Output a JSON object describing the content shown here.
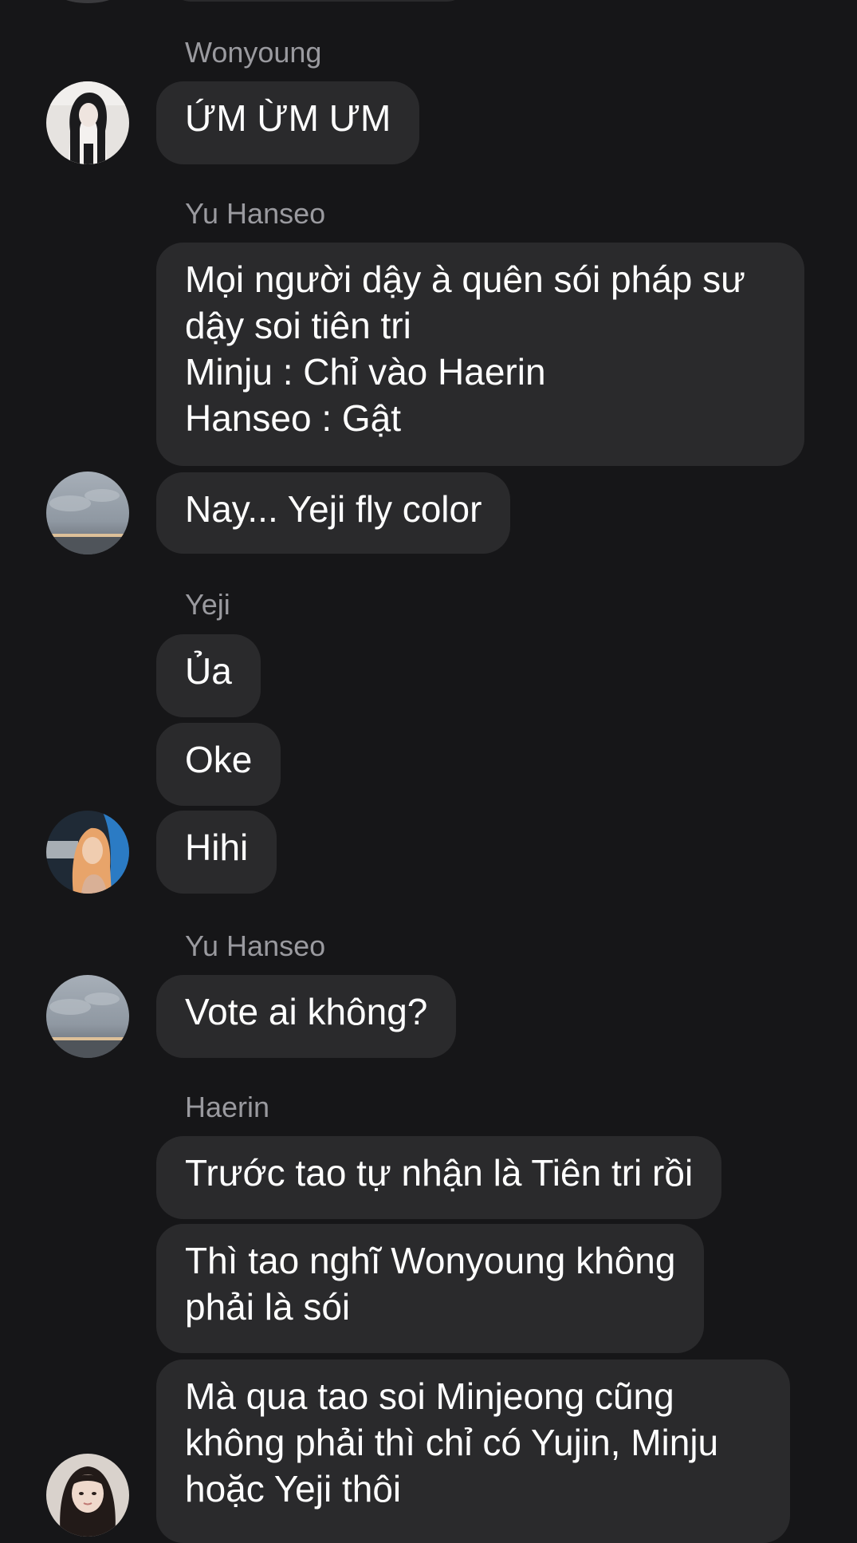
{
  "messages": [
    {
      "sender": "Wonyoung",
      "text": "ỨM ỪM ƯM"
    },
    {
      "sender": "Yu Hanseo",
      "text": "Mọi người dậy à quên sói pháp sư\ndậy soi tiên tri\nMinju : Chỉ vào Haerin\nHanseo : Gật"
    },
    {
      "text": "Nay... Yeji fly color"
    },
    {
      "sender": "Yeji",
      "text": "Ủa"
    },
    {
      "text": "Oke"
    },
    {
      "text": "Hihi"
    },
    {
      "sender": "Yu Hanseo",
      "text": "Vote ai không?"
    },
    {
      "sender": "Haerin",
      "text": "Trước tao tự nhận là Tiên tri rồi"
    },
    {
      "text": "Thì tao nghĩ Wonyoung không\nphải là sói"
    },
    {
      "text": "Mà qua tao soi Minjeong cũng\nkhông phải thì chỉ có Yujin, Minju\nhoặc Yeji thôi"
    }
  ],
  "avatars": [
    {
      "icon": "wonyoung-avatar",
      "colors": [
        "#e6e3e0",
        "#1b1b1d"
      ]
    },
    {
      "icon": "yu-hanseo-avatar",
      "colors": [
        "#9aa3ad",
        "#6b7076"
      ]
    },
    {
      "icon": "yeji-avatar",
      "colors": [
        "#2c4a66",
        "#e8a46a"
      ]
    },
    {
      "icon": "yu-hanseo-avatar",
      "colors": [
        "#9aa3ad",
        "#6b7076"
      ]
    },
    {
      "icon": "haerin-avatar",
      "colors": [
        "#d9d2cc",
        "#221a18"
      ]
    }
  ],
  "theme": {
    "background": "#161618",
    "bubble": "#2a2a2c",
    "sender_name": "#9a9a9f",
    "text": "#ffffff"
  }
}
